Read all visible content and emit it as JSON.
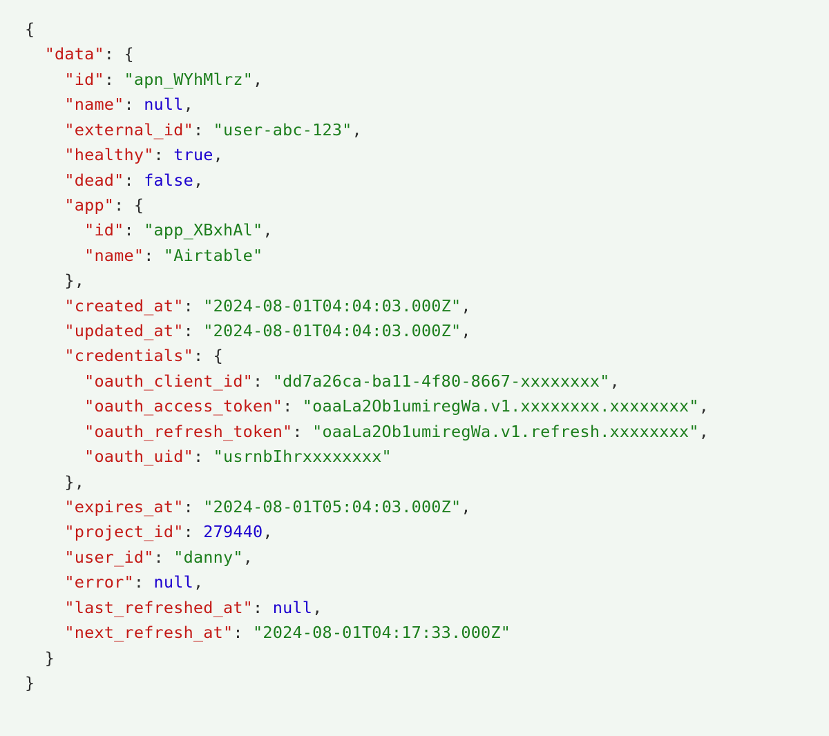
{
  "json_payload": {
    "data": {
      "id": "apn_WYhMlrz",
      "name": null,
      "external_id": "user-abc-123",
      "healthy": true,
      "dead": false,
      "app": {
        "id": "app_XBxhAl",
        "name": "Airtable"
      },
      "created_at": "2024-08-01T04:04:03.000Z",
      "updated_at": "2024-08-01T04:04:03.000Z",
      "credentials": {
        "oauth_client_id": "dd7a26ca-ba11-4f80-8667-xxxxxxxx",
        "oauth_access_token": "oaaLa2Ob1umiregWa.v1.xxxxxxxx.xxxxxxxx",
        "oauth_refresh_token": "oaaLa2Ob1umiregWa.v1.refresh.xxxxxxxx",
        "oauth_uid": "usrnbIhrxxxxxxxx"
      },
      "expires_at": "2024-08-01T05:04:03.000Z",
      "project_id": 279440,
      "user_id": "danny",
      "error": null,
      "last_refreshed_at": null,
      "next_refresh_at": "2024-08-01T04:17:33.000Z"
    }
  },
  "indent_unit": "  "
}
